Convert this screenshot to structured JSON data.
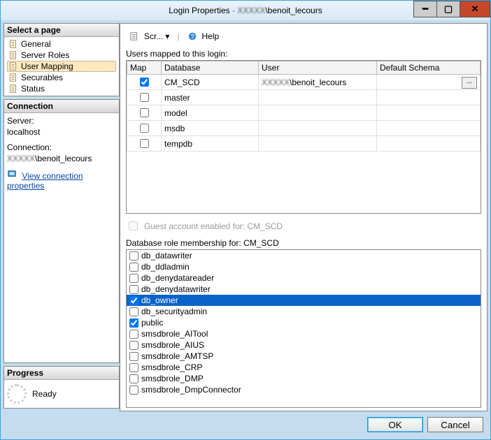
{
  "window": {
    "title_prefix": "Login Properties · ",
    "title_user": "\\benoit_lecours"
  },
  "left": {
    "select_page": "Select a page",
    "pages": [
      {
        "label": "General",
        "sel": false
      },
      {
        "label": "Server Roles",
        "sel": false
      },
      {
        "label": "User Mapping",
        "sel": true
      },
      {
        "label": "Securables",
        "sel": false
      },
      {
        "label": "Status",
        "sel": false
      }
    ],
    "connection_hdr": "Connection",
    "server_lbl": "Server:",
    "server_val": "localhost",
    "conn_lbl": "Connection:",
    "conn_val": "\\benoit_lecours",
    "view_conn": "View connection properties",
    "progress_hdr": "Progress",
    "progress_val": "Ready"
  },
  "toolbar": {
    "script": "Scr...",
    "help": "Help"
  },
  "main": {
    "mapped_lbl": "Users mapped to this login:",
    "cols": {
      "map": "Map",
      "db": "Database",
      "user": "User",
      "schema": "Default Schema"
    },
    "rows": [
      {
        "checked": true,
        "db": "CM_SCD",
        "user": "\\benoit_lecours",
        "ell": true
      },
      {
        "checked": false,
        "db": "master",
        "user": "",
        "ell": false
      },
      {
        "checked": false,
        "db": "model",
        "user": "",
        "ell": false
      },
      {
        "checked": false,
        "db": "msdb",
        "user": "",
        "ell": false
      },
      {
        "checked": false,
        "db": "tempdb",
        "user": "",
        "ell": false
      }
    ],
    "guest": "Guest account enabled for: CM_SCD",
    "roles_lbl": "Database role membership for: CM_SCD",
    "roles": [
      {
        "label": "db_datawriter",
        "checked": false,
        "sel": false
      },
      {
        "label": "db_ddladmin",
        "checked": false,
        "sel": false
      },
      {
        "label": "db_denydatareader",
        "checked": false,
        "sel": false
      },
      {
        "label": "db_denydatawriter",
        "checked": false,
        "sel": false
      },
      {
        "label": "db_owner",
        "checked": true,
        "sel": true
      },
      {
        "label": "db_securityadmin",
        "checked": false,
        "sel": false
      },
      {
        "label": "public",
        "checked": true,
        "sel": false
      },
      {
        "label": "smsdbrole_AITool",
        "checked": false,
        "sel": false
      },
      {
        "label": "smsdbrole_AIUS",
        "checked": false,
        "sel": false
      },
      {
        "label": "smsdbrole_AMTSP",
        "checked": false,
        "sel": false
      },
      {
        "label": "smsdbrole_CRP",
        "checked": false,
        "sel": false
      },
      {
        "label": "smsdbrole_DMP",
        "checked": false,
        "sel": false
      },
      {
        "label": "smsdbrole_DmpConnector",
        "checked": false,
        "sel": false
      }
    ]
  },
  "buttons": {
    "ok": "OK",
    "cancel": "Cancel"
  }
}
